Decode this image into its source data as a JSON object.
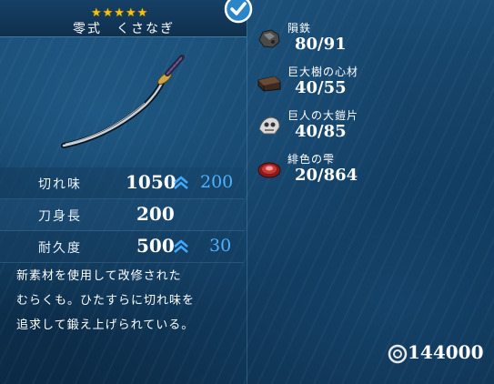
{
  "weapon": {
    "rarity_stars": 5,
    "stars_text": "★★★★★",
    "name": "零式　くさなぎ",
    "selected": true
  },
  "stats": [
    {
      "label": "切れ味",
      "value": "1050",
      "arrow": true,
      "bonus": "200"
    },
    {
      "label": "刀身長",
      "value": "200",
      "arrow": false,
      "bonus": ""
    },
    {
      "label": "耐久度",
      "value": "500",
      "arrow": true,
      "bonus": "30"
    }
  ],
  "description": [
    "新素材を使用して改修された",
    "むらくも。ひたすらに切れ味を",
    "追求して鍛え上げられている。"
  ],
  "materials": [
    {
      "icon": "meteorite-ore-icon",
      "name": "隕鉄",
      "count": "80/91"
    },
    {
      "icon": "tree-heartwood-icon",
      "name": "巨大樹の心材",
      "count": "40/55"
    },
    {
      "icon": "giant-armor-shard-icon",
      "name": "巨人の大鎧片",
      "count": "40/85"
    },
    {
      "icon": "scarlet-drop-icon",
      "name": "緋色の雫",
      "count": "20/864"
    }
  ],
  "money": {
    "icon": "coin-icon",
    "value": "144000"
  },
  "colors": {
    "star": "#f2c318",
    "bonus": "#4fb2ff",
    "panel": "#0f3556"
  }
}
